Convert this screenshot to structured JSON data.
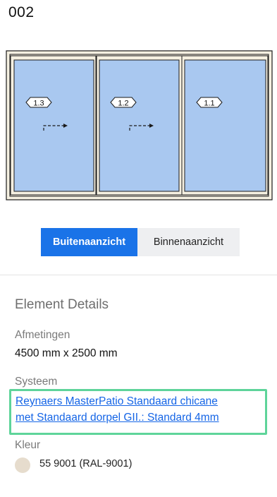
{
  "header": {
    "title": "002"
  },
  "window": {
    "panels": [
      {
        "label": "1.3",
        "sliding_arrow": true
      },
      {
        "label": "1.2",
        "sliding_arrow": true
      },
      {
        "label": "1.1",
        "sliding_arrow": false
      }
    ],
    "colors": {
      "frame": "#f5f0e1",
      "glass": "#a9c8f0",
      "outline": "#1a1a1a"
    }
  },
  "view_toggle": {
    "outside_label": "Buitenaanzicht",
    "inside_label": "Binnenaanzicht",
    "selected": "outside",
    "active_color": "#1a73e8"
  },
  "details": {
    "title": "Element Details",
    "dimensions_label": "Afmetingen",
    "dimensions_value": "4500 mm x 2500 mm",
    "system_label": "Systeem",
    "system_line1": "Reynaers MasterPatio Standaard chicane",
    "system_line2": "met Standaard dorpel GII.: Standard 4mm",
    "color_label": "Kleur",
    "color_value": "55 9001 (RAL-9001)",
    "color_swatch": "#e6dccd",
    "highlight_color": "#5ed49a"
  }
}
